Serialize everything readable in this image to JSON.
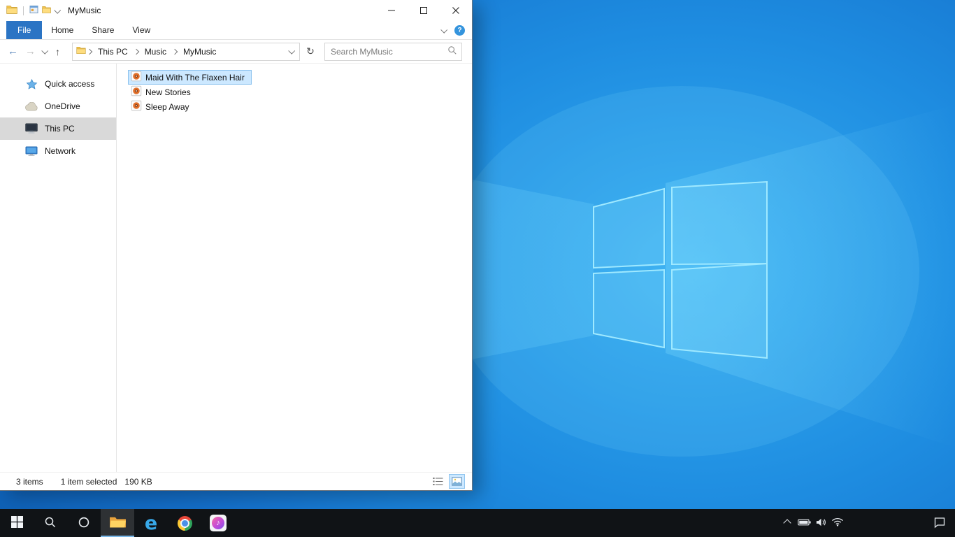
{
  "window": {
    "title": "MyMusic"
  },
  "ribbon": {
    "tabs": [
      "File",
      "Home",
      "Share",
      "View"
    ],
    "help_label": "?"
  },
  "navigation": {
    "back_glyph": "←",
    "forward_glyph": "→",
    "up_glyph": "↑",
    "refresh_glyph": "↻"
  },
  "address": {
    "crumbs": [
      "This PC",
      "Music",
      "MyMusic"
    ],
    "search_placeholder": "Search MyMusic"
  },
  "sidebar": {
    "items": [
      {
        "label": "Quick access",
        "icon": "star-icon"
      },
      {
        "label": "OneDrive",
        "icon": "cloud-icon"
      },
      {
        "label": "This PC",
        "icon": "monitor-icon",
        "selected": true
      },
      {
        "label": "Network",
        "icon": "network-icon"
      }
    ]
  },
  "files": [
    {
      "name": "Maid With The Flaxen Hair",
      "selected": true
    },
    {
      "name": "New Stories",
      "selected": false
    },
    {
      "name": "Sleep Away",
      "selected": false
    }
  ],
  "statusbar": {
    "count": "3 items",
    "selection": "1 item selected",
    "size": "190 KB"
  },
  "taskbar": {
    "edge_glyph": "e",
    "itunes_glyph": "♪"
  },
  "colors": {
    "file_tab_accent": "#2b74c4",
    "selection_bg": "#cce8ff",
    "selection_border": "#8ac2ee",
    "sidebar_selected_bg": "#d9d9d9",
    "taskbar_bg": "#101316",
    "active_app_underline": "#7ab8e8",
    "wallpaper_blue": "#1e8ce0"
  }
}
